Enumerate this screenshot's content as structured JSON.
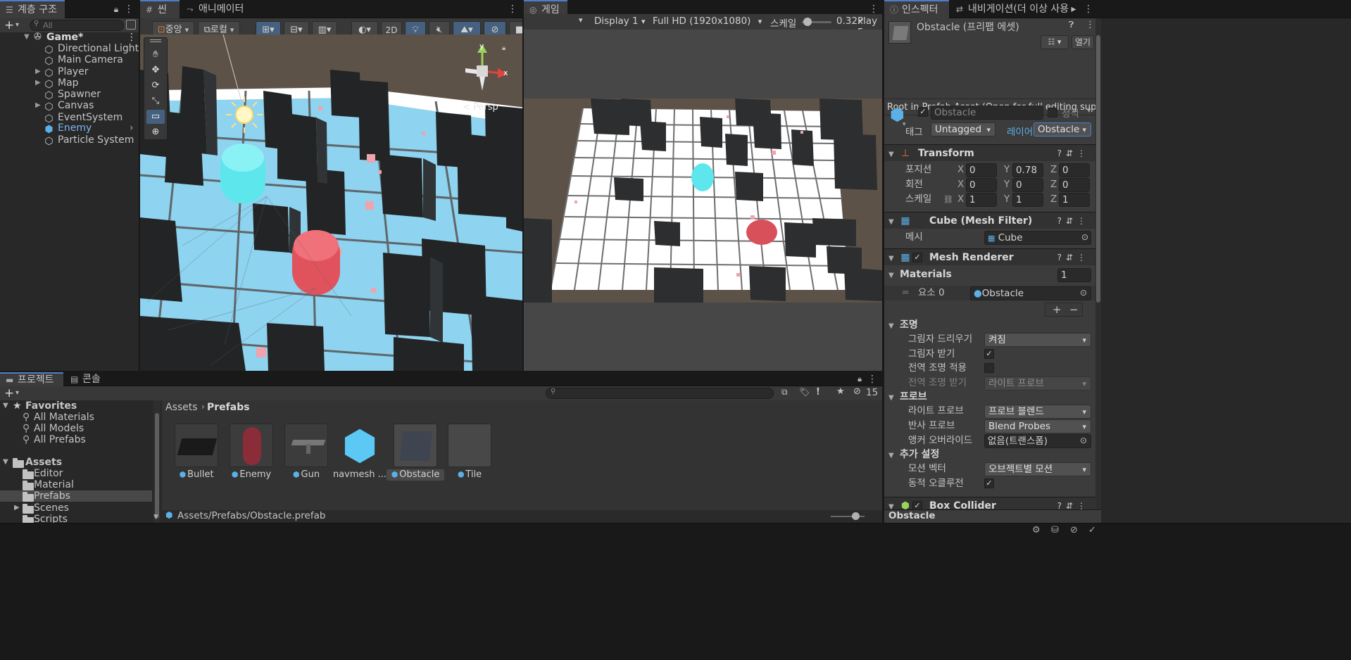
{
  "hierarchy": {
    "tab_label": "계층 구조",
    "add_label": "+",
    "search_placeholder": "All",
    "scene_name": "Game*",
    "items": [
      {
        "label": "Directional Light"
      },
      {
        "label": "Main Camera"
      },
      {
        "label": "Player"
      },
      {
        "label": "Map"
      },
      {
        "label": "Spawner"
      },
      {
        "label": "Canvas"
      },
      {
        "label": "EventSystem"
      },
      {
        "label": "Enemy"
      },
      {
        "label": "Particle System"
      }
    ]
  },
  "scene": {
    "tab_label": "씬",
    "animator_tab_label": "애니메이터",
    "pivot_label": "중앙",
    "local_label": "로컬",
    "mode_2d_label": "2D",
    "persp_label": "< Persp",
    "axis_y": "y",
    "axis_x": "x"
  },
  "game": {
    "tab_label": "게임",
    "display_label": "Display 1",
    "resolution_label": "Full HD (1920x1080)",
    "scale_label": "스케일",
    "scale_value": "0.32x",
    "scale_level": 0.05,
    "play_label": "Play F"
  },
  "inspector": {
    "tab_label": "인스펙터",
    "nav_tab_label": "내비게이션(더 이상 사용...",
    "title": "Obstacle (프리팹 에셋)",
    "open_label": "열기",
    "root_notice": "Root in Prefab Asset (Open for full editing suppo",
    "object_name": "Obstacle",
    "static_label": "정적",
    "tag_label": "태그",
    "tag_value": "Untagged",
    "layer_label": "레이어",
    "layer_value": "Obstacle",
    "transform": {
      "title": "Transform",
      "position_label": "포지션",
      "rotation_label": "회전",
      "scale_label": "스케일",
      "position": {
        "x": "0",
        "y": "0.78",
        "z": "0"
      },
      "rotation": {
        "x": "0",
        "y": "0",
        "z": "0"
      },
      "scale": {
        "x": "1",
        "y": "1",
        "z": "1"
      }
    },
    "mesh_filter": {
      "title": "Cube (Mesh Filter)",
      "mesh_label": "메시",
      "mesh_value": "Cube"
    },
    "mesh_renderer": {
      "title": "Mesh Renderer",
      "materials_label": "Materials",
      "materials_count": "1",
      "element_label": "요소 0",
      "element_value": "Obstacle",
      "lighting_label": "조명",
      "cast_shadows_label": "그림자 드리우기",
      "cast_shadows_value": "켜짐",
      "receive_shadows_label": "그림자 받기",
      "gi_label": "전역 조명 적용",
      "receive_gi_label": "전역 조명 받기",
      "receive_gi_value": "라이트 프로브",
      "probes_label": "프로브",
      "light_probes_label": "라이트 프로브",
      "light_probes_value": "프로브 블렌드",
      "reflection_probes_label": "반사 프로브",
      "reflection_probes_value": "Blend Probes",
      "anchor_override_label": "앵커 오버라이드",
      "anchor_override_value": "없음(트랜스폼)",
      "additional_label": "추가 설정",
      "motion_vectors_label": "모션 벡터",
      "motion_vectors_value": "오브젝트별 모션",
      "dynamic_occlusion_label": "동적 오클루전"
    },
    "box_collider": {
      "title": "Box Collider"
    },
    "footer_label": "Obstacle"
  },
  "project": {
    "tab_label": "프로젝트",
    "console_tab_label": "콘솔",
    "hidden_count": "15",
    "favorites_label": "Favorites",
    "favorites": [
      "All Materials",
      "All Models",
      "All Prefabs"
    ],
    "assets_label": "Assets",
    "folders": [
      "Editor",
      "Material",
      "Prefabs",
      "Scenes",
      "Scripts"
    ],
    "breadcrumb_root": "Assets",
    "breadcrumb_current": "Prefabs",
    "items": [
      "Bullet",
      "Enemy",
      "Gun",
      "navmesh ...",
      "Obstacle",
      "Tile"
    ],
    "path": "Assets/Prefabs/Obstacle.prefab"
  }
}
